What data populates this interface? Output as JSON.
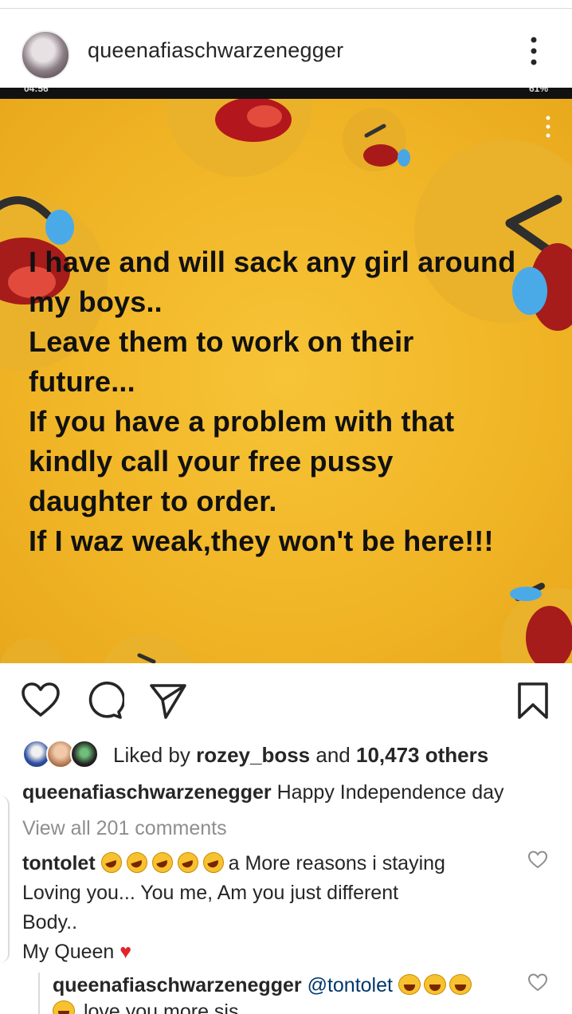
{
  "post": {
    "username": "queenafiaschwarzenegger",
    "more_icon": "more-vertical-icon"
  },
  "image": {
    "status_left": "04:56",
    "status_right": "61%",
    "quote_lines": [
      "I have and will sack any girl around",
      "my boys..",
      "Leave them to work on their",
      "future...",
      "If you have a problem with that",
      "kindly call your free pussy",
      "daughter to order.",
      "If I waz weak,they won't be here!!!"
    ],
    "background_color": "#f2b928"
  },
  "actions": {
    "like_icon": "heart-outline-icon",
    "comment_icon": "comment-bubble-icon",
    "share_icon": "send-paper-plane-icon",
    "save_icon": "bookmark-icon"
  },
  "likes": {
    "prefix": "Liked by ",
    "user": "rozey_boss",
    "middle": " and ",
    "count": "10,473 others"
  },
  "caption": {
    "username": "queenafiaschwarzenegger",
    "text": " Happy Independence day"
  },
  "view_all": "View all 201 comments",
  "comments": [
    {
      "username": "tontolet",
      "text_after_emoji": "a More reasons i staying",
      "line2": "Loving you... You me, Am you just different",
      "line3": "Body..",
      "line4": "My Queen",
      "like_icon": "heart-outline-icon"
    }
  ],
  "reply": {
    "username": "queenafiaschwarzenegger",
    "mention": "@tontolet",
    "line2": "love you more sis",
    "like_icon": "heart-outline-icon"
  }
}
